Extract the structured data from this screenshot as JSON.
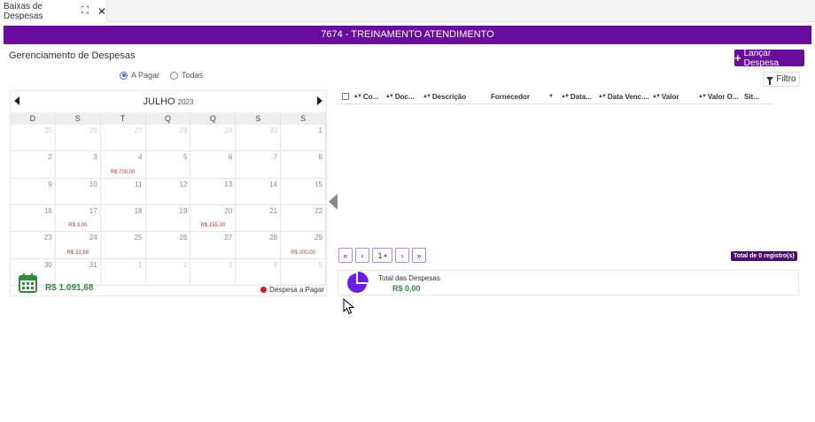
{
  "tab": {
    "label": "Baixas de Despesas",
    "expand_glyph": "⛶",
    "close_glyph": "✕"
  },
  "header": {
    "title": "7674 - TREINAMENTO ATENDIMENTO"
  },
  "page": {
    "title": "Gerenciamento de Despesas"
  },
  "toolbar": {
    "add_label": "Lançar Despesa",
    "filter_label": "Filtro"
  },
  "filter_options": {
    "a_pagar": "A Pagar",
    "todas": "Todas",
    "selected": "A Pagar"
  },
  "calendar": {
    "month": "JULHO",
    "year": "2023",
    "weekdays": [
      "D",
      "S",
      "T",
      "Q",
      "Q",
      "S",
      "S"
    ],
    "days": [
      {
        "n": "25",
        "muted": true,
        "amount": ""
      },
      {
        "n": "26",
        "muted": true,
        "amount": ""
      },
      {
        "n": "27",
        "muted": true,
        "amount": ""
      },
      {
        "n": "28",
        "muted": true,
        "amount": ""
      },
      {
        "n": "29",
        "muted": true,
        "amount": ""
      },
      {
        "n": "30",
        "muted": true,
        "amount": ""
      },
      {
        "n": "1",
        "muted": false,
        "amount": ""
      },
      {
        "n": "2",
        "muted": false,
        "amount": ""
      },
      {
        "n": "3",
        "muted": false,
        "amount": ""
      },
      {
        "n": "4",
        "muted": false,
        "amount": "R$ 700,00"
      },
      {
        "n": "5",
        "muted": false,
        "amount": ""
      },
      {
        "n": "6",
        "muted": false,
        "amount": ""
      },
      {
        "n": "7",
        "muted": false,
        "amount": ""
      },
      {
        "n": "8",
        "muted": false,
        "amount": ""
      },
      {
        "n": "9",
        "muted": false,
        "amount": ""
      },
      {
        "n": "10",
        "muted": false,
        "amount": ""
      },
      {
        "n": "11",
        "muted": false,
        "amount": ""
      },
      {
        "n": "12",
        "muted": false,
        "amount": ""
      },
      {
        "n": "13",
        "muted": false,
        "amount": ""
      },
      {
        "n": "14",
        "muted": false,
        "amount": ""
      },
      {
        "n": "15",
        "muted": false,
        "amount": ""
      },
      {
        "n": "16",
        "muted": false,
        "amount": ""
      },
      {
        "n": "17",
        "muted": false,
        "amount": "R$ 3,00"
      },
      {
        "n": "18",
        "muted": false,
        "amount": ""
      },
      {
        "n": "19",
        "muted": false,
        "amount": ""
      },
      {
        "n": "20",
        "muted": false,
        "amount": "R$ 155,00"
      },
      {
        "n": "21",
        "muted": false,
        "amount": ""
      },
      {
        "n": "22",
        "muted": false,
        "amount": ""
      },
      {
        "n": "23",
        "muted": false,
        "amount": ""
      },
      {
        "n": "24",
        "muted": false,
        "amount": "R$ 33,68"
      },
      {
        "n": "25",
        "muted": false,
        "amount": ""
      },
      {
        "n": "26",
        "muted": false,
        "amount": ""
      },
      {
        "n": "27",
        "muted": false,
        "amount": ""
      },
      {
        "n": "28",
        "muted": false,
        "amount": ""
      },
      {
        "n": "29",
        "muted": false,
        "amount": "R$ 200,00"
      },
      {
        "n": "30",
        "muted": false,
        "amount": ""
      },
      {
        "n": "31",
        "muted": false,
        "amount": ""
      },
      {
        "n": "1",
        "muted": true,
        "amount": ""
      },
      {
        "n": "2",
        "muted": true,
        "amount": ""
      },
      {
        "n": "3",
        "muted": true,
        "amount": ""
      },
      {
        "n": "4",
        "muted": true,
        "amount": ""
      },
      {
        "n": "5",
        "muted": true,
        "amount": ""
      }
    ],
    "total": "R$ 1.091,68",
    "legend": "Despesa a Pagar"
  },
  "grid": {
    "columns": [
      {
        "label": "Co...",
        "w": 36,
        "sort": "updown"
      },
      {
        "label": "Doc...",
        "w": 42,
        "sort": "updown"
      },
      {
        "label": "Descrição",
        "w": 77,
        "sort": "updown"
      },
      {
        "label": "Fornecedor",
        "w": 79,
        "sort": "down"
      },
      {
        "label": "Data...",
        "w": 42,
        "sort": "updown"
      },
      {
        "label": "Data Venc....",
        "w": 61,
        "sort": "updown"
      },
      {
        "label": "Valor",
        "w": 52,
        "sort": "updown"
      },
      {
        "label": "Valor O...",
        "w": 52,
        "sort": "updown"
      },
      {
        "label": "Sit...",
        "w": 30,
        "sort": ""
      }
    ],
    "pager": {
      "first": "«",
      "prev": "‹",
      "page": "1",
      "page_caret": "▴",
      "next": "›",
      "last": "»"
    },
    "total_records": "Total de 0 registro(s)"
  },
  "summary": {
    "label": "Total das Despesas",
    "value": "R$ 0,00"
  },
  "colors": {
    "primary": "#6a0c9c",
    "success": "#2e8b3a",
    "danger": "#d01c1c"
  }
}
